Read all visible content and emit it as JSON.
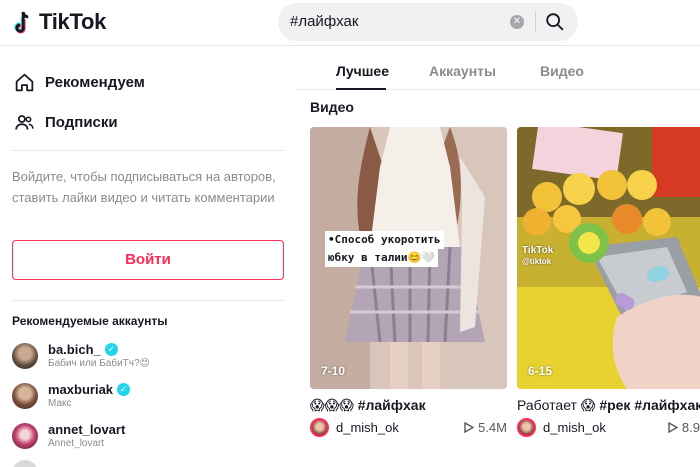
{
  "header": {
    "logo_text": "TikTok",
    "search_query": "#лайфхак"
  },
  "sidebar": {
    "nav": [
      {
        "label": "Рекомендуем",
        "icon": "home-icon"
      },
      {
        "label": "Подписки",
        "icon": "following-icon"
      }
    ],
    "login_hint": "Войдите, чтобы подписываться на авторов, ставить лайки видео и читать комментарии",
    "login_button": "Войти",
    "recommended_title": "Рекомендуемые аккаунты",
    "accounts": [
      {
        "name": "ba.bich_",
        "sub": "Бабич или БабиТч?😊",
        "verified": true
      },
      {
        "name": "maxburiak",
        "sub": "Макс",
        "verified": true
      },
      {
        "name": "annet_lovart",
        "sub": "Annet_lovart",
        "verified": false
      }
    ]
  },
  "tabs": [
    "Лучшее",
    "Аккаунты",
    "Видео"
  ],
  "section_title": "Видео",
  "videos": [
    {
      "count": "7-10",
      "overlay": [
        "•Способ укоротить",
        "юбку в талии😊🤍"
      ],
      "caption_emoji": "😱😱😱",
      "caption_tag": "#лайфхак",
      "author": "d_mish_ok",
      "views": "5.4M"
    },
    {
      "count": "6-15",
      "caption_prefix": "Работает 😱",
      "caption_tag": "#рек #лайфхак",
      "author": "d_mish_ok",
      "views": "8.9",
      "watermark": "TikTok",
      "watermark_sub": "@tiktok"
    }
  ],
  "colors": {
    "accent": "#fe2c55",
    "verified": "#20d5ec",
    "text": "#161823",
    "muted": "#8a8b91"
  }
}
